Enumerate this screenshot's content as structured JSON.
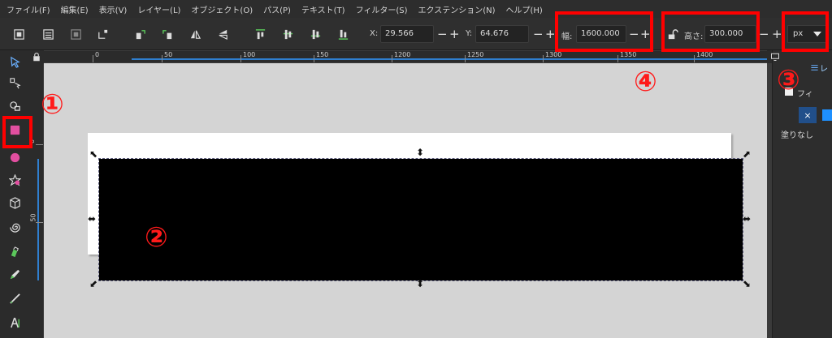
{
  "menu": [
    "ファイル(F)",
    "編集(E)",
    "表示(V)",
    "レイヤー(L)",
    "オブジェクト(O)",
    "パス(P)",
    "テキスト(T)",
    "フィルター(S)",
    "エクステンション(N)",
    "ヘルプ(H)"
  ],
  "toolbar": {
    "x_label": "X:",
    "x_value": "29.566",
    "y_label": "Y:",
    "y_value": "64.676",
    "w_label": "幅:",
    "w_value": "1600.000",
    "h_label": "高さ:",
    "h_value": "300.000",
    "unit": "px",
    "minus": "−",
    "plus": "+"
  },
  "ruler_top_labels": [
    "0",
    "50",
    "100",
    "150",
    "1200",
    "1250",
    "1300",
    "1350",
    "1400"
  ],
  "ruler_left_labels": [
    "0",
    "50"
  ],
  "markers": [
    "①",
    "②",
    "③",
    "④"
  ],
  "panel": {
    "tab_label": "レ",
    "row1": "フィ",
    "row2": "塗りなし",
    "close_x": "×"
  },
  "colors": {
    "highlight": "#ff0000",
    "rect_tool": "#e24fa0",
    "accent": "#1e90ff"
  }
}
